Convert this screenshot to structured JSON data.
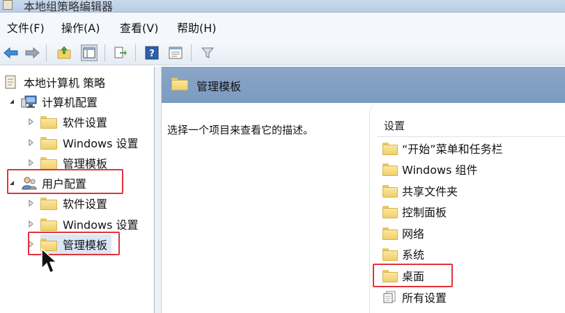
{
  "window": {
    "title": "本地组策略编辑器"
  },
  "menu": [
    {
      "label": "文件(F)"
    },
    {
      "label": "操作(A)"
    },
    {
      "label": "查看(V)"
    },
    {
      "label": "帮助(H)"
    }
  ],
  "toolbar": {
    "icons": [
      "back-arrow-icon",
      "forward-arrow-icon",
      "up-folder-icon",
      "show-hide-tree-icon",
      "export-list-icon",
      "help-icon",
      "properties-icon",
      "filter-icon"
    ]
  },
  "tree": {
    "root": {
      "label": "本地计算机 策略"
    },
    "computer": {
      "label": "计算机配置",
      "children": [
        "软件设置",
        "Windows 设置",
        "管理模板"
      ]
    },
    "user": {
      "label": "用户配置",
      "children": [
        "软件设置",
        "Windows 设置",
        "管理模板"
      ]
    }
  },
  "details": {
    "header_title": "管理模板",
    "description": "选择一个项目来查看它的描述。",
    "column_header": "设置",
    "items": [
      {
        "label": "“开始”菜单和任务栏"
      },
      {
        "label": "Windows 组件"
      },
      {
        "label": "共享文件夹"
      },
      {
        "label": "控制面板"
      },
      {
        "label": "网络"
      },
      {
        "label": "系统"
      },
      {
        "label": "桌面"
      },
      {
        "label": "所有设置"
      }
    ]
  },
  "highlight_color": "#e2323b"
}
